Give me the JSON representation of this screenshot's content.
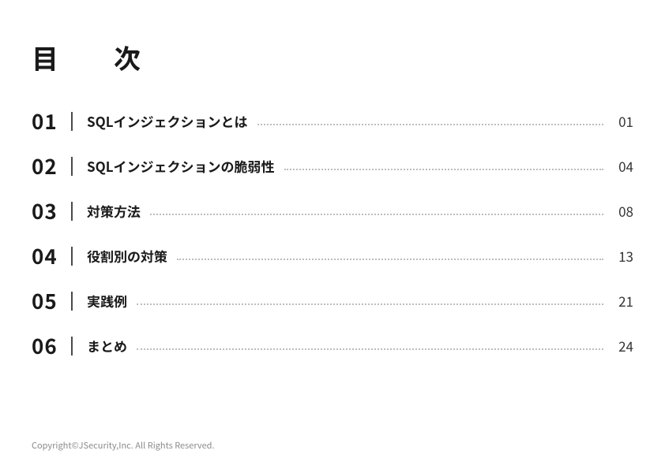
{
  "heading": "目　次",
  "toc": [
    {
      "num": "01",
      "title": "SQLインジェクションとは",
      "page": "01"
    },
    {
      "num": "02",
      "title": "SQLインジェクションの脆弱性",
      "page": "04"
    },
    {
      "num": "03",
      "title": "対策方法",
      "page": "08"
    },
    {
      "num": "04",
      "title": "役割別の対策",
      "page": "13"
    },
    {
      "num": "05",
      "title": "実践例",
      "page": "21"
    },
    {
      "num": "06",
      "title": "まとめ",
      "page": "24"
    }
  ],
  "footer": "Copyright©JSecurity,Inc. All Rights Reserved."
}
